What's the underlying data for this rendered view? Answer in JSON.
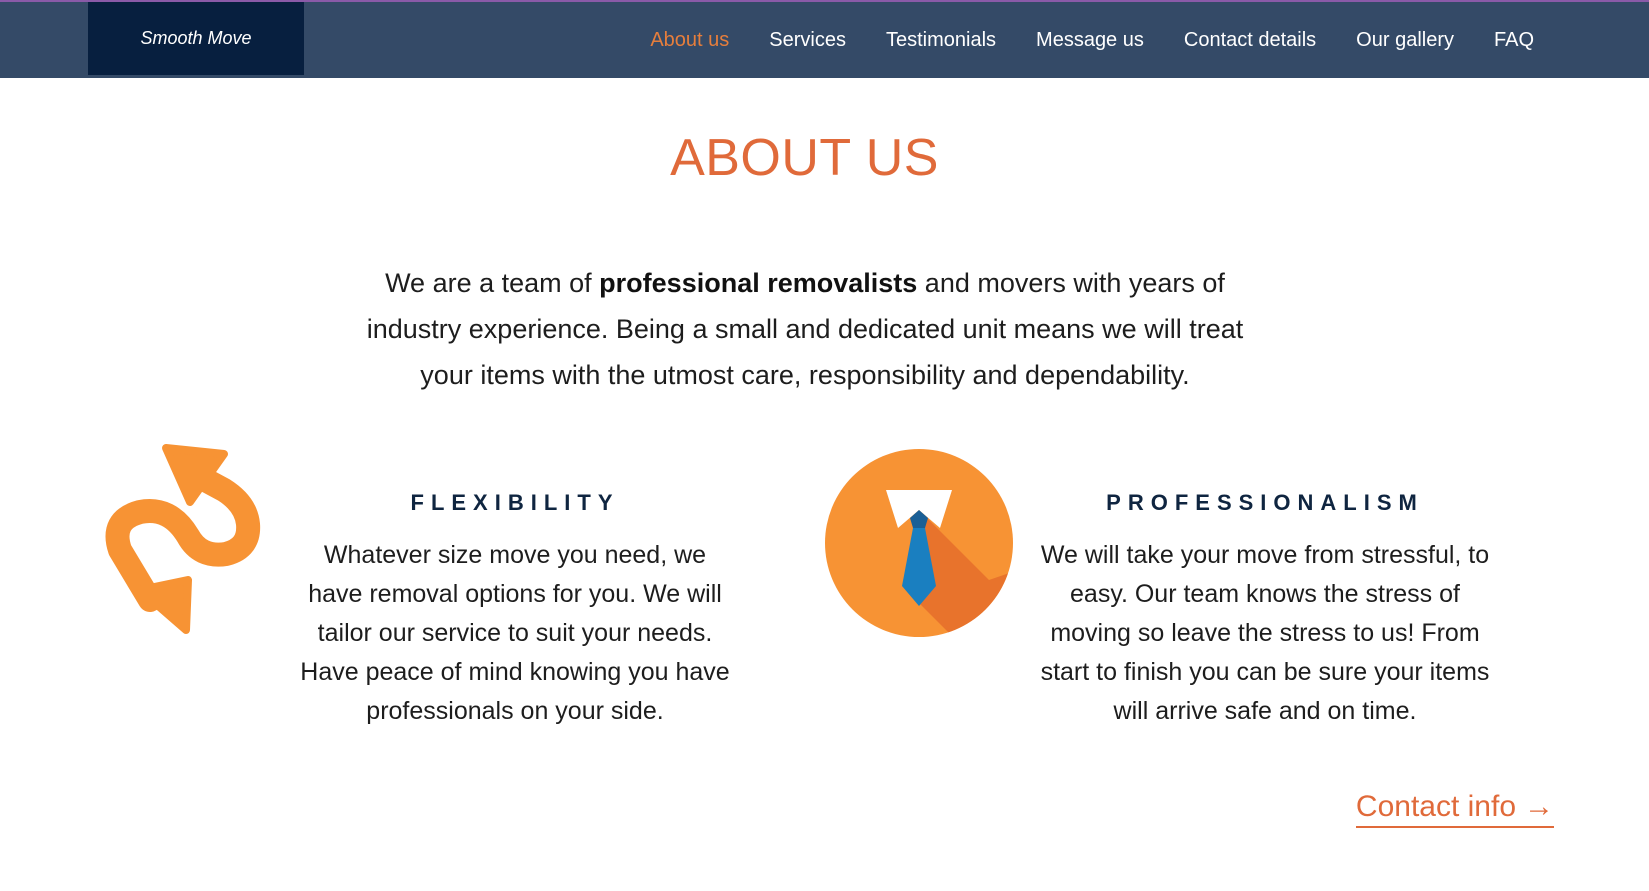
{
  "brand": {
    "logo_text": "Smooth Move"
  },
  "nav": {
    "items": [
      {
        "label": "About us",
        "active": true
      },
      {
        "label": "Services"
      },
      {
        "label": "Testimonials"
      },
      {
        "label": "Message us"
      },
      {
        "label": "Contact details"
      },
      {
        "label": "Our gallery"
      },
      {
        "label": "FAQ"
      }
    ]
  },
  "main": {
    "title": "ABOUT US",
    "intro_before": "We are a team of ",
    "intro_bold": "professional removalists",
    "intro_after": " and movers with years of industry experience. Being a small and dedicated unit means we will treat your items with the utmost care, responsibility and dependability."
  },
  "features": [
    {
      "heading": "FLEXIBILITY",
      "text": "Whatever size move you need, we have removal options for you. We will tailor our service to suit your needs. Have peace of mind knowing you have professionals on your side.",
      "icon": "flexible-arrows-icon"
    },
    {
      "heading": "PROFESSIONALISM",
      "text": "We will take your move from stressful, to easy. Our team knows the stress of moving so leave the stress to us! From start to finish you can be sure your items will arrive safe and on time.",
      "icon": "tie-icon"
    }
  ],
  "contact_link": {
    "label": "Contact info",
    "icon": "arrow-right-icon"
  },
  "colors": {
    "nav_bg": "#344a67",
    "logo_bg": "#071f3f",
    "accent": "#e06a3a",
    "icon_orange": "#f79334",
    "heading_dark": "#0f2540"
  }
}
